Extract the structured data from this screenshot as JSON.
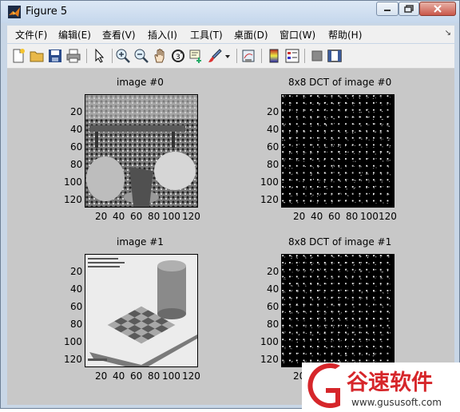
{
  "window": {
    "title": "Figure 5"
  },
  "menu": [
    "文件(F)",
    "编辑(E)",
    "查看(V)",
    "插入(I)",
    "工具(T)",
    "桌面(D)",
    "窗口(W)",
    "帮助(H)"
  ],
  "toolbar_icons": [
    "new-figure-icon",
    "open-file-icon",
    "save-icon",
    "print-icon",
    "pointer-icon",
    "zoom-in-icon",
    "zoom-out-icon",
    "pan-hand-icon",
    "rotate-3d-icon",
    "data-cursor-icon",
    "brush-icon",
    "brush-dropdown-icon",
    "link-plot-icon",
    "colorbar-icon",
    "legend-icon",
    "hide-plot-tools-icon",
    "show-plot-tools-icon"
  ],
  "axes": [
    {
      "title": "image #0",
      "xticks": [
        "20",
        "40",
        "60",
        "80",
        "100",
        "120"
      ],
      "yticks": [
        "20",
        "40",
        "60",
        "80",
        "100",
        "120"
      ]
    },
    {
      "title": "8x8 DCT of image #0",
      "xticks": [
        "20",
        "40",
        "60",
        "80",
        "100",
        "120"
      ],
      "yticks": [
        "20",
        "40",
        "60",
        "80",
        "100",
        "120"
      ]
    },
    {
      "title": "image #1",
      "xticks": [
        "20",
        "40",
        "60",
        "80",
        "100",
        "120"
      ],
      "yticks": [
        "20",
        "40",
        "60",
        "80",
        "100",
        "120"
      ]
    },
    {
      "title": "8x8 DCT of image #1",
      "xticks": [
        "20",
        "40",
        "60",
        "80",
        "100",
        "120"
      ],
      "yticks": [
        "20",
        "40",
        "60",
        "80",
        "100",
        "120"
      ]
    }
  ],
  "watermark": {
    "brand": "谷速软件",
    "url": "www.gususoft.com",
    "color": "#d6262a"
  }
}
